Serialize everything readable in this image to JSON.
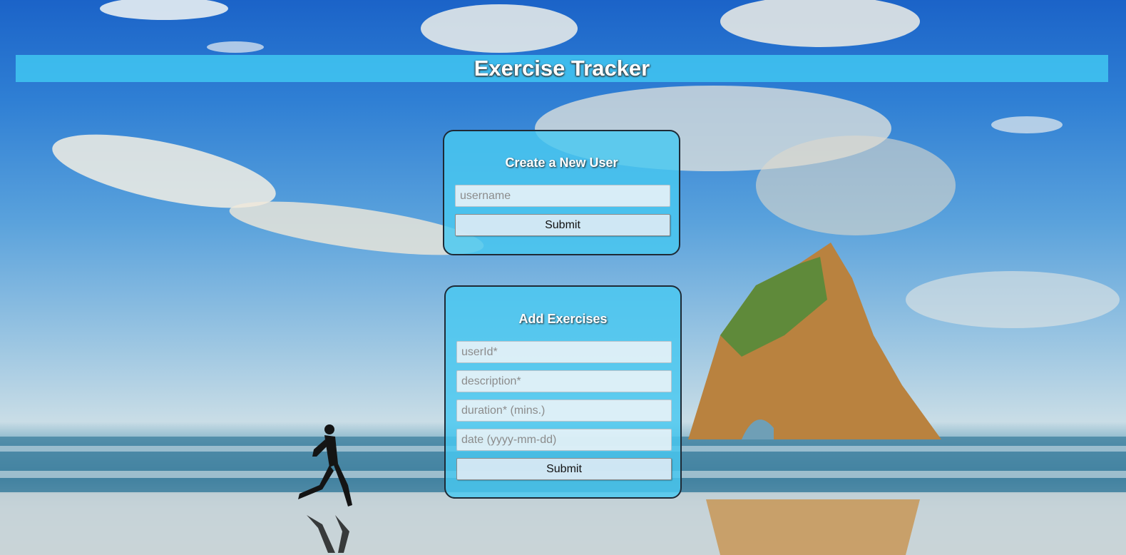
{
  "header": {
    "title": "Exercise Tracker"
  },
  "new_user_form": {
    "heading": "Create a New User",
    "username_placeholder": "username",
    "username_value": "",
    "submit_label": "Submit"
  },
  "exercise_form": {
    "heading": "Add Exercises",
    "userid_placeholder": "userId*",
    "description_placeholder": "description*",
    "duration_placeholder": "duration* (mins.)",
    "date_placeholder": "date (yyyy-mm-dd)",
    "submit_label": "Submit"
  },
  "theme": {
    "accent": "#40c4f0",
    "card_border": "#1e2a36"
  }
}
